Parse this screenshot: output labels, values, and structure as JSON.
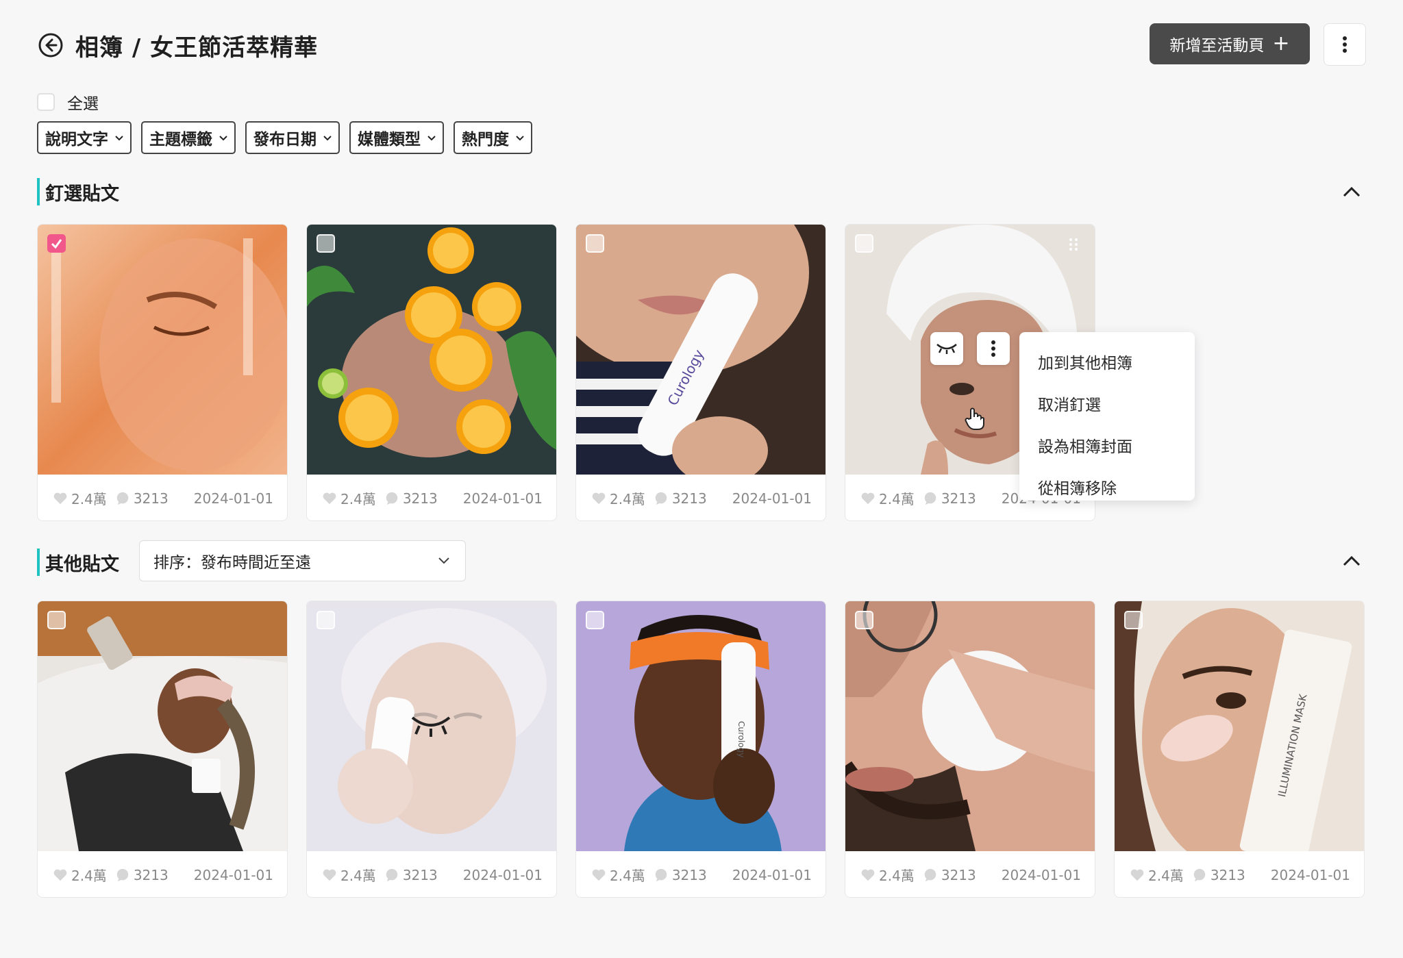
{
  "header": {
    "title": "相簿 / 女王節活萃精華",
    "add_button_label": "新增至活動頁",
    "add_button_icon": "plus-icon"
  },
  "select_all_label": "全選",
  "filters": [
    "說明文字",
    "主題標籤",
    "發布日期",
    "媒體類型",
    "熱門度"
  ],
  "pinned": {
    "title": "釘選貼文",
    "posts": [
      {
        "likes": "2.4萬",
        "comments": "3213",
        "date": "2024-01-01",
        "checked": true
      },
      {
        "likes": "2.4萬",
        "comments": "3213",
        "date": "2024-01-01",
        "checked": false
      },
      {
        "likes": "2.4萬",
        "comments": "3213",
        "date": "2024-01-01",
        "checked": false
      },
      {
        "likes": "2.4萬",
        "comments": "3213",
        "date": "2024-01-01",
        "checked": false
      }
    ]
  },
  "context_menu": {
    "items": [
      "加到其他相簿",
      "取消釘選",
      "設為相簿封面",
      "從相簿移除"
    ]
  },
  "others": {
    "title": "其他貼文",
    "sort_label": "排序：發布時間近至遠",
    "posts": [
      {
        "likes": "2.4萬",
        "comments": "3213",
        "date": "2024-01-01",
        "hidden": false
      },
      {
        "likes": "2.4萬",
        "comments": "3213",
        "date": "2024-01-01",
        "hidden": true
      },
      {
        "likes": "2.4萬",
        "comments": "3213",
        "date": "2024-01-01",
        "hidden": false
      },
      {
        "likes": "2.4萬",
        "comments": "3213",
        "date": "2024-01-01",
        "hidden": false
      },
      {
        "likes": "2.4萬",
        "comments": "3213",
        "date": "2024-01-01",
        "hidden": false
      }
    ]
  },
  "image_text": {
    "curology_bottle": "Curology",
    "illumination_mask": "ILLUMINATION MASK"
  },
  "colors": {
    "accent": "#1fc2c0",
    "checked": "#f2578c",
    "primary_button": "#4a4a4a"
  }
}
